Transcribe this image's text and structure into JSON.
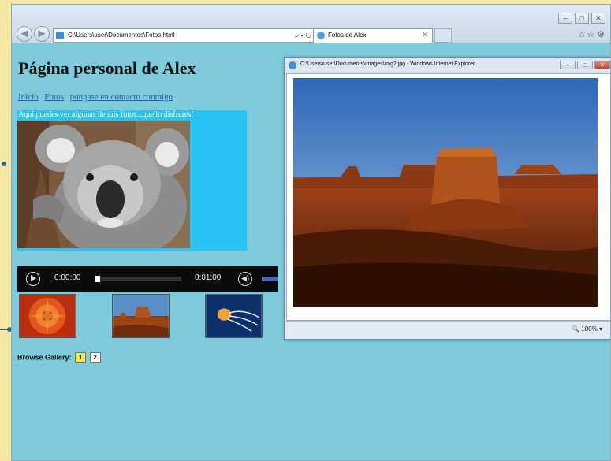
{
  "browser": {
    "address": "C:\\Users\\user\\Documentos\\Fotos.html",
    "tab_title": "Fotos de Alex"
  },
  "page": {
    "title": "Página personal de Alex",
    "nav": [
      "Inicio",
      "Fotos",
      "pongase en contacto conmigo"
    ],
    "photo_caption": "Aqui  puedes ver algunas de mis fotos...que lo disfrutes!"
  },
  "player": {
    "current_time": "0:00:00",
    "duration": "0:01:00",
    "progress": 0.0
  },
  "gallery": {
    "label": "Browse Gallery:",
    "pages": [
      "1",
      "2"
    ],
    "active_page": "1"
  },
  "popup": {
    "title": "C:\\Users\\user\\Documents\\images\\img2.jpg - Windows Internet Explorer",
    "zoom": "100%"
  },
  "colors": {
    "page_bg": "#7ecbdb",
    "photo_panel": "#29c4f4",
    "active_page": "#f2ea47"
  }
}
